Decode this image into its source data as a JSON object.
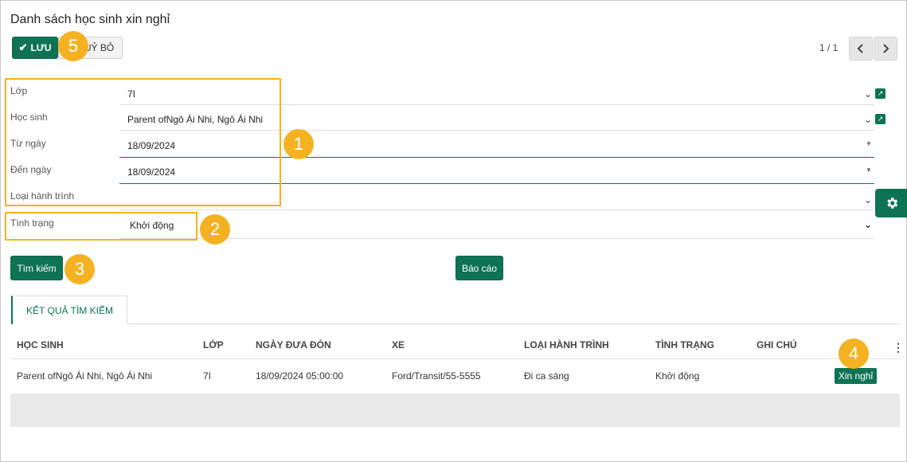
{
  "page": {
    "title": "Danh sách học sinh xin nghỉ"
  },
  "toolbar": {
    "save_label": "LƯU",
    "cancel_label": "UỶ BỎ",
    "pager_text": "1 / 1"
  },
  "form": {
    "class_label": "Lớp",
    "class_value": "7I",
    "student_label": "Học sinh",
    "student_value": "Parent ofNgô Ái Nhi, Ngô Ái Nhi",
    "from_date_label": "Từ ngày",
    "from_date_value": "18/09/2024",
    "to_date_label": "Đến ngày",
    "to_date_value": "18/09/2024",
    "route_type_label": "Loại hành trình",
    "route_type_value": "",
    "status_label": "Tình trạng",
    "status_value": "Khởi động"
  },
  "actions": {
    "search_label": "Tìm kiếm",
    "report_label": "Báo cáo"
  },
  "tabs": {
    "results_label": "KẾT QUẢ TÌM KIẾM"
  },
  "table": {
    "headers": [
      "HỌC SINH",
      "LỚP",
      "NGÀY ĐƯA ĐÓN",
      "XE",
      "LOẠI HÀNH TRÌNH",
      "TÌNH TRẠNG",
      "GHI CHÚ"
    ],
    "rows": [
      {
        "student": "Parent ofNgô Ái Nhi, Ngô Ái Nhi",
        "class": "7I",
        "pickup_date": "18/09/2024 05:00:00",
        "vehicle": "Ford/Transit/55-5555",
        "route_type": "Đi ca sáng",
        "status": "Khởi động",
        "note": "",
        "action_label": "Xin nghỉ"
      }
    ]
  },
  "annotations": [
    "1",
    "2",
    "3",
    "4",
    "5"
  ],
  "colors": {
    "primary": "#0e7353",
    "highlight": "#f4b223"
  },
  "icons": {
    "save": "check-icon",
    "prev": "chevron-left-icon",
    "next": "chevron-right-icon",
    "dropdown": "chevron-down-icon",
    "external": "external-link-icon",
    "settings": "gear-icon",
    "more": "kebab-icon"
  }
}
